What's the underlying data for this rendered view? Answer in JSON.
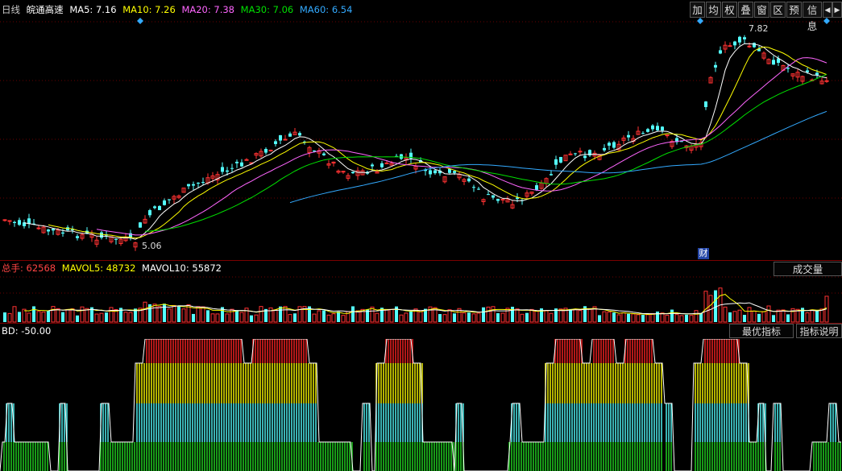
{
  "header": {
    "period": "日线",
    "stock_name": "皖通高速",
    "ma": [
      {
        "label": "MA5: 7.16",
        "color": "#ffffff"
      },
      {
        "label": "MA10: 7.26",
        "color": "#ffff00"
      },
      {
        "label": "MA20: 7.38",
        "color": "#ff66ff"
      },
      {
        "label": "MA30: 7.06",
        "color": "#00e000"
      },
      {
        "label": "MA60: 6.54",
        "color": "#33aaff"
      }
    ]
  },
  "toolbar": {
    "items": [
      "加",
      "均",
      "权",
      "叠",
      "窗",
      "区",
      "预",
      "信息"
    ],
    "nav_prev": "◀",
    "nav_next": "▶"
  },
  "price_chart": {
    "high_label": "7.82",
    "low_label": "5.06",
    "fin_marker": "财",
    "colors": {
      "up": "#ff3232",
      "down": "#54ffff",
      "ma5": "#ffffff",
      "ma10": "#ffff00",
      "ma20": "#ff66ff",
      "ma30": "#00e000",
      "ma60": "#33aaff"
    }
  },
  "volume": {
    "total_label": "总手: 62568",
    "mavol5": "MAVOL5: 48732",
    "mavol10": "MAVOL10: 55872",
    "dropdown": "成交量"
  },
  "indicator": {
    "label": "BD: -50.00",
    "best_button": "最优指标",
    "help_button": "指标说明"
  }
}
